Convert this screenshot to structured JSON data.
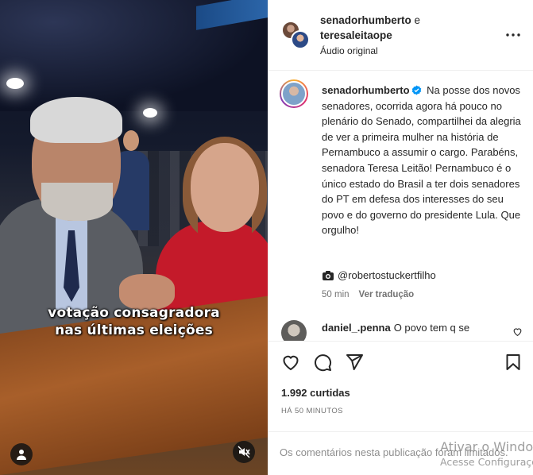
{
  "media": {
    "caption_line1": "votação consagradora",
    "caption_line2": "nas últimas eleições",
    "user_button_icon": "user-icon",
    "mute_button_icon": "muted-speaker-icon"
  },
  "header": {
    "user1": "senadorhumberto",
    "connector": " e",
    "user2": "teresaleitaope",
    "audio": "Áudio original",
    "more_icon": "more-horizontal-icon"
  },
  "post_caption": {
    "username": "senadorhumberto",
    "verified": true,
    "text": "Na posse dos novos senadores, ocorrida agora há pouco no plenário do Senado, compartilhei da alegria de ver a primeira mulher na história de Pernambuco a assumir o cargo. Parabéns, senadora Teresa Leitão! Pernambuco é o único estado do Brasil a ter dois senadores do PT em defesa dos interesses do seu povo e do governo do presidente Lula. Que orgulho!",
    "credit": "@robertostuckertfilho",
    "credit_icon": "camera-icon",
    "time": "50 min",
    "translate": "Ver tradução"
  },
  "comment": {
    "username": "daniel_.penna",
    "text": "O povo tem q se"
  },
  "actions": {
    "like_icon": "heart-icon",
    "comment_icon": "comment-icon",
    "share_icon": "send-icon",
    "save_icon": "bookmark-icon"
  },
  "likes": "1.992 curtidas",
  "posted": "HÁ 50 MINUTOS",
  "comment_box": {
    "placeholder": "Os comentários nesta publicação foram limitados."
  },
  "watermark": {
    "line1": "Ativar o Windows",
    "line2": "Acesse Configurações"
  },
  "colors": {
    "text": "#262626",
    "muted": "#737373",
    "border": "#efefef",
    "verified": "#0095f6"
  }
}
